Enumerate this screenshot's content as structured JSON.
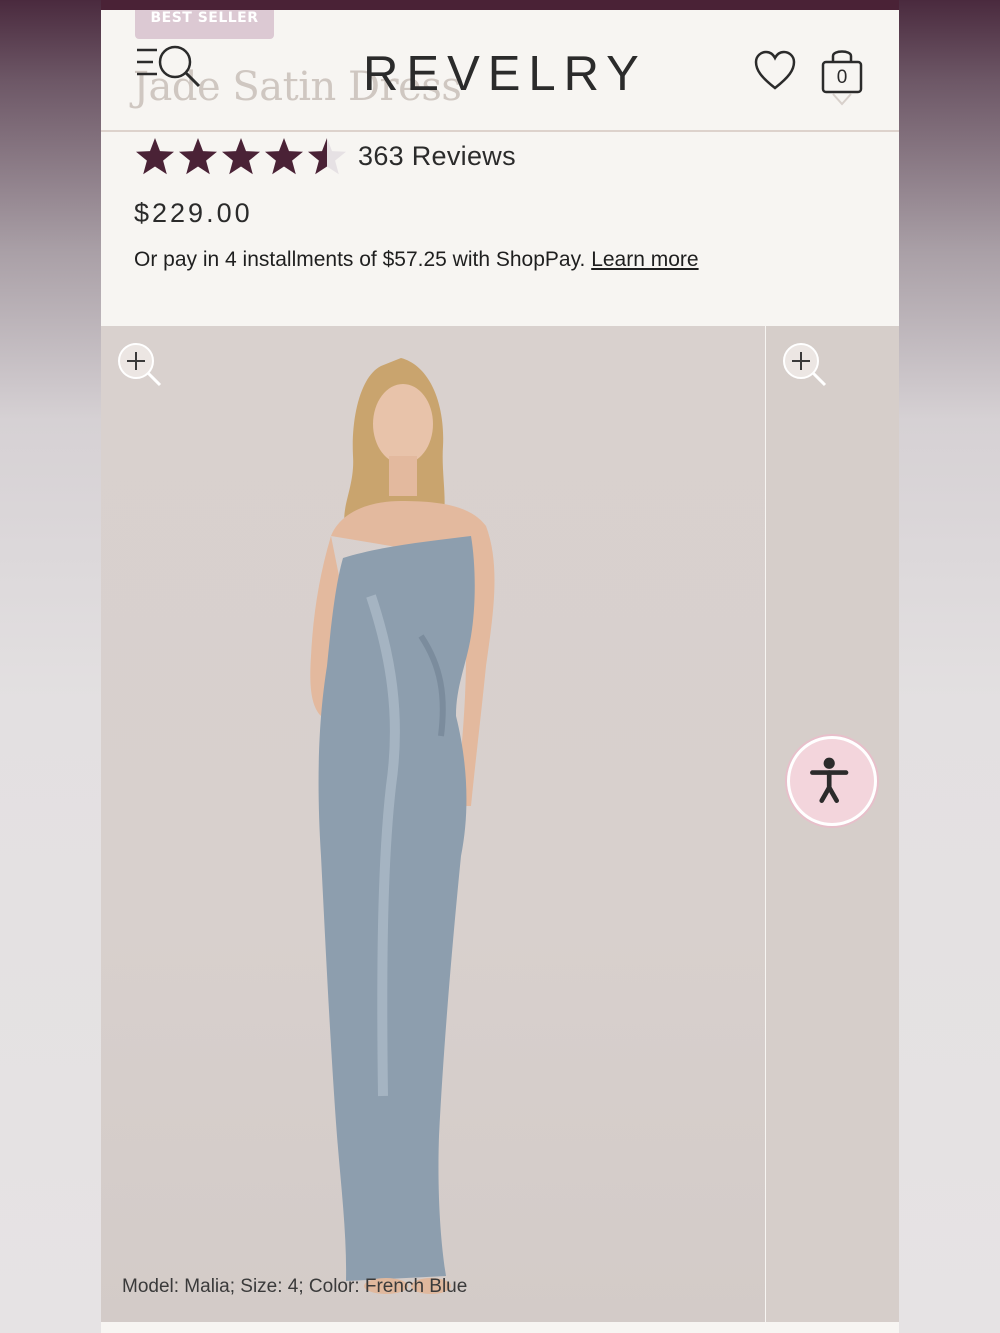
{
  "header": {
    "badge": "BEST SELLER",
    "ghost_title": "Jade Satin Dress",
    "logo": "REVELRY",
    "cart_count": "0"
  },
  "product": {
    "rating": 4.5,
    "rating_max": 5,
    "reviews_label": "363 Reviews",
    "price": "$229.00",
    "installments_text": "Or pay in 4 installments of $57.25 with ShopPay.",
    "learn_more": "Learn more"
  },
  "gallery": {
    "caption": "Model: Malia; Size: 4; Color: French Blue",
    "dress_color": "#8d9eae"
  },
  "colors": {
    "brand_dark": "#4a2236",
    "star_color": "#4a2236",
    "badge_bg": "#dcc9d3",
    "accessibility_bg": "#f3d5dc"
  },
  "icons": {
    "menu": "menu-search-icon",
    "wishlist": "heart-icon",
    "cart": "shopping-bag-icon",
    "zoom": "zoom-in-icon",
    "accessibility": "accessibility-icon"
  }
}
